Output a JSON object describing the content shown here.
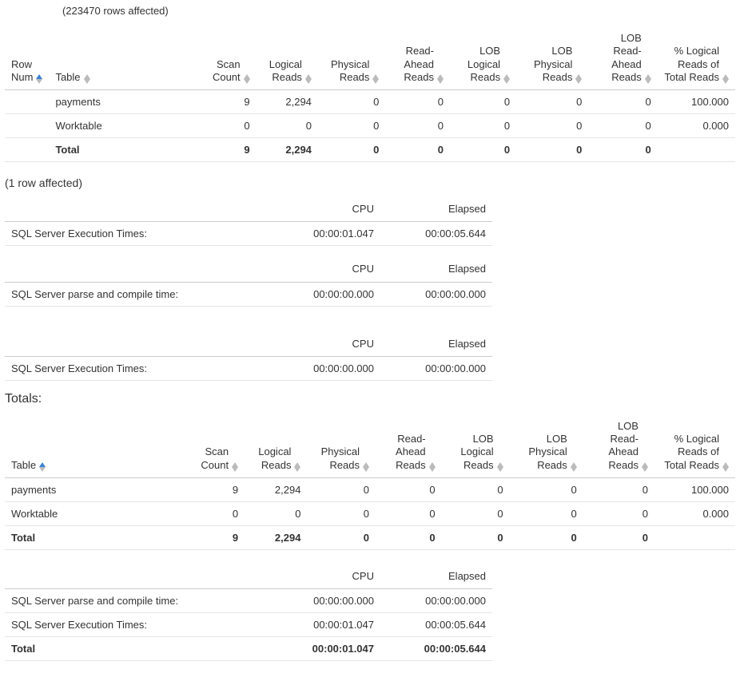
{
  "rowsAffectedText": "(223470 rows affected)",
  "ioTable1": {
    "headers": [
      "Row Num",
      "Table",
      "Scan Count",
      "Logical Reads",
      "Physical Reads",
      "Read-Ahead Reads",
      "LOB Logical Reads",
      "LOB Physical Reads",
      "LOB Read-Ahead Reads",
      "% Logical Reads of Total Reads"
    ],
    "rows": [
      {
        "rownum": "",
        "table": "payments",
        "scan": "9",
        "logical": "2,294",
        "physical": "0",
        "readahead": "0",
        "loblogical": "0",
        "lobphysical": "0",
        "lobreadahead": "0",
        "pct": "100.000"
      },
      {
        "rownum": "",
        "table": "Worktable",
        "scan": "0",
        "logical": "0",
        "physical": "0",
        "readahead": "0",
        "loblogical": "0",
        "lobphysical": "0",
        "lobreadahead": "0",
        "pct": "0.000"
      }
    ],
    "total": {
      "rownum": "",
      "table": "Total",
      "scan": "9",
      "logical": "2,294",
      "physical": "0",
      "readahead": "0",
      "loblogical": "0",
      "lobphysical": "0",
      "lobreadahead": "0",
      "pct": ""
    }
  },
  "oneRowAffectedText": "(1 row affected)",
  "timeTables": [
    {
      "headers": [
        "",
        "CPU",
        "Elapsed"
      ],
      "row": {
        "label": "SQL Server Execution Times:",
        "cpu": "00:00:01.047",
        "elapsed": "00:00:05.644"
      }
    },
    {
      "headers": [
        "",
        "CPU",
        "Elapsed"
      ],
      "row": {
        "label": "SQL Server parse and compile time:",
        "cpu": "00:00:00.000",
        "elapsed": "00:00:00.000"
      }
    },
    {
      "headers": [
        "",
        "CPU",
        "Elapsed"
      ],
      "row": {
        "label": "SQL Server Execution Times:",
        "cpu": "00:00:00.000",
        "elapsed": "00:00:00.000"
      }
    }
  ],
  "totalsLabel": "Totals:",
  "ioTable2": {
    "headers": [
      "Table",
      "Scan Count",
      "Logical Reads",
      "Physical Reads",
      "Read-Ahead Reads",
      "LOB Logical Reads",
      "LOB Physical Reads",
      "LOB Read-Ahead Reads",
      "% Logical Reads of Total Reads"
    ],
    "rows": [
      {
        "table": "payments",
        "scan": "9",
        "logical": "2,294",
        "physical": "0",
        "readahead": "0",
        "loblogical": "0",
        "lobphysical": "0",
        "lobreadahead": "0",
        "pct": "100.000"
      },
      {
        "table": "Worktable",
        "scan": "0",
        "logical": "0",
        "physical": "0",
        "readahead": "0",
        "loblogical": "0",
        "lobphysical": "0",
        "lobreadahead": "0",
        "pct": "0.000"
      }
    ],
    "total": {
      "table": "Total",
      "scan": "9",
      "logical": "2,294",
      "physical": "0",
      "readahead": "0",
      "loblogical": "0",
      "lobphysical": "0",
      "lobreadahead": "0",
      "pct": ""
    }
  },
  "timeSummary": {
    "headers": [
      "",
      "CPU",
      "Elapsed"
    ],
    "rows": [
      {
        "label": "SQL Server parse and compile time:",
        "cpu": "00:00:00.000",
        "elapsed": "00:00:00.000"
      },
      {
        "label": "SQL Server Execution Times:",
        "cpu": "00:00:01.047",
        "elapsed": "00:00:05.644"
      }
    ],
    "total": {
      "label": "Total",
      "cpu": "00:00:01.047",
      "elapsed": "00:00:05.644"
    }
  }
}
